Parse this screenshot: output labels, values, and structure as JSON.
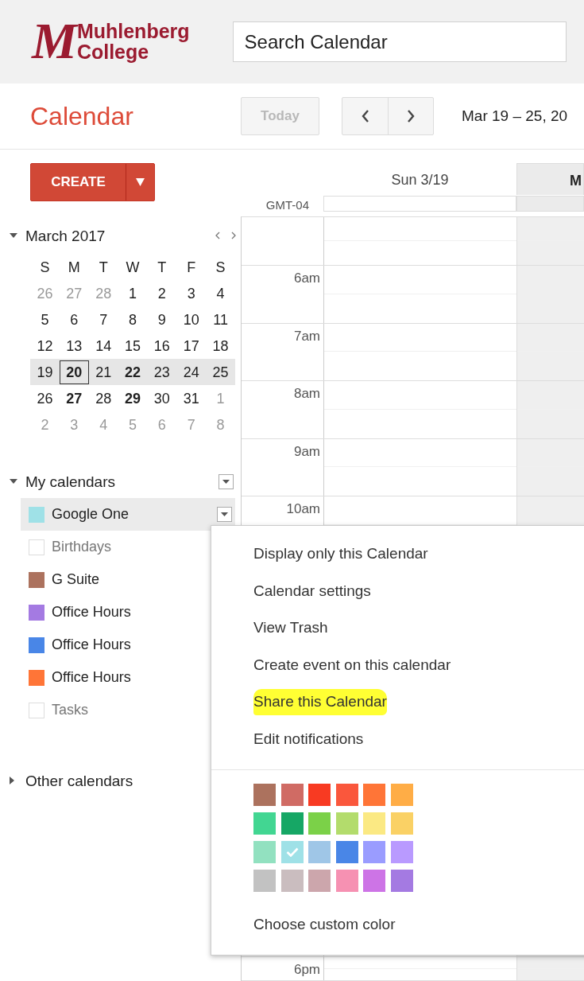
{
  "logo": {
    "monogram": "M",
    "lines": [
      "Muhlenberg",
      "College"
    ]
  },
  "search": {
    "placeholder": "Search Calendar"
  },
  "app_title": "Calendar",
  "toolbar": {
    "today": {
      "label": "Today",
      "disabled": true
    },
    "date_range": "Mar 19 – 25, 20"
  },
  "create": {
    "label": "CREATE"
  },
  "mini_calendar": {
    "title": "March 2017",
    "expanded": true,
    "weekdays": [
      "S",
      "M",
      "T",
      "W",
      "T",
      "F",
      "S"
    ],
    "weeks": [
      {
        "selected": false,
        "days": [
          {
            "label": "26",
            "other_month": true,
            "has_events": false,
            "today": false
          },
          {
            "label": "27",
            "other_month": true,
            "has_events": false,
            "today": false
          },
          {
            "label": "28",
            "other_month": true,
            "has_events": false,
            "today": false
          },
          {
            "label": "1",
            "other_month": false,
            "has_events": false,
            "today": false
          },
          {
            "label": "2",
            "other_month": false,
            "has_events": false,
            "today": false
          },
          {
            "label": "3",
            "other_month": false,
            "has_events": false,
            "today": false
          },
          {
            "label": "4",
            "other_month": false,
            "has_events": false,
            "today": false
          }
        ]
      },
      {
        "selected": false,
        "days": [
          {
            "label": "5",
            "other_month": false,
            "has_events": false,
            "today": false
          },
          {
            "label": "6",
            "other_month": false,
            "has_events": false,
            "today": false
          },
          {
            "label": "7",
            "other_month": false,
            "has_events": false,
            "today": false
          },
          {
            "label": "8",
            "other_month": false,
            "has_events": false,
            "today": false
          },
          {
            "label": "9",
            "other_month": false,
            "has_events": false,
            "today": false
          },
          {
            "label": "10",
            "other_month": false,
            "has_events": false,
            "today": false
          },
          {
            "label": "11",
            "other_month": false,
            "has_events": false,
            "today": false
          }
        ]
      },
      {
        "selected": false,
        "days": [
          {
            "label": "12",
            "other_month": false,
            "has_events": false,
            "today": false
          },
          {
            "label": "13",
            "other_month": false,
            "has_events": false,
            "today": false
          },
          {
            "label": "14",
            "other_month": false,
            "has_events": false,
            "today": false
          },
          {
            "label": "15",
            "other_month": false,
            "has_events": false,
            "today": false
          },
          {
            "label": "16",
            "other_month": false,
            "has_events": false,
            "today": false
          },
          {
            "label": "17",
            "other_month": false,
            "has_events": false,
            "today": false
          },
          {
            "label": "18",
            "other_month": false,
            "has_events": false,
            "today": false
          }
        ]
      },
      {
        "selected": true,
        "days": [
          {
            "label": "19",
            "other_month": false,
            "has_events": false,
            "today": false
          },
          {
            "label": "20",
            "other_month": false,
            "has_events": true,
            "today": true
          },
          {
            "label": "21",
            "other_month": false,
            "has_events": false,
            "today": false
          },
          {
            "label": "22",
            "other_month": false,
            "has_events": true,
            "today": false
          },
          {
            "label": "23",
            "other_month": false,
            "has_events": false,
            "today": false
          },
          {
            "label": "24",
            "other_month": false,
            "has_events": false,
            "today": false
          },
          {
            "label": "25",
            "other_month": false,
            "has_events": false,
            "today": false
          }
        ]
      },
      {
        "selected": false,
        "days": [
          {
            "label": "26",
            "other_month": false,
            "has_events": false,
            "today": false
          },
          {
            "label": "27",
            "other_month": false,
            "has_events": true,
            "today": false
          },
          {
            "label": "28",
            "other_month": false,
            "has_events": false,
            "today": false
          },
          {
            "label": "29",
            "other_month": false,
            "has_events": true,
            "today": false
          },
          {
            "label": "30",
            "other_month": false,
            "has_events": false,
            "today": false
          },
          {
            "label": "31",
            "other_month": false,
            "has_events": false,
            "today": false
          },
          {
            "label": "1",
            "other_month": true,
            "has_events": false,
            "today": false
          }
        ]
      },
      {
        "selected": false,
        "days": [
          {
            "label": "2",
            "other_month": true,
            "has_events": false,
            "today": false
          },
          {
            "label": "3",
            "other_month": true,
            "has_events": false,
            "today": false
          },
          {
            "label": "4",
            "other_month": true,
            "has_events": false,
            "today": false
          },
          {
            "label": "5",
            "other_month": true,
            "has_events": false,
            "today": false
          },
          {
            "label": "6",
            "other_month": true,
            "has_events": false,
            "today": false
          },
          {
            "label": "7",
            "other_month": true,
            "has_events": false,
            "today": false
          },
          {
            "label": "8",
            "other_month": true,
            "has_events": false,
            "today": false
          }
        ]
      }
    ]
  },
  "my_calendars": {
    "title": "My calendars",
    "expanded": true,
    "items": [
      {
        "label": "Google One",
        "checked": true,
        "color": "#9fe1e7",
        "selected": true
      },
      {
        "label": "Birthdays",
        "checked": false,
        "selected": false
      },
      {
        "label": "G Suite",
        "checked": true,
        "color": "#ac725e",
        "selected": false
      },
      {
        "label": "Office Hours",
        "checked": true,
        "color": "#a47ae2",
        "selected": false
      },
      {
        "label": "Office Hours",
        "checked": true,
        "color": "#4986e7",
        "selected": false
      },
      {
        "label": "Office Hours",
        "checked": true,
        "color": "#ff7537",
        "selected": false
      },
      {
        "label": "Tasks",
        "checked": false,
        "selected": false
      }
    ]
  },
  "other_calendars": {
    "title": "Other calendars",
    "expanded": false
  },
  "week_view": {
    "timezone": "GMT-04",
    "days": [
      {
        "label": "Sun 3/19",
        "today": false
      },
      {
        "label": "M",
        "today": true
      }
    ],
    "hours": [
      "6am",
      "7am",
      "8am",
      "9am",
      "10am"
    ],
    "bottom_hour": "6pm"
  },
  "menu": {
    "items": [
      {
        "label": "Display only this Calendar",
        "highlighted": false
      },
      {
        "label": "Calendar settings",
        "highlighted": false
      },
      {
        "label": "View Trash",
        "highlighted": false
      },
      {
        "label": "Create event on this calendar",
        "highlighted": false
      },
      {
        "label": "Share this Calendar",
        "highlighted": true
      },
      {
        "label": "Edit notifications",
        "highlighted": false
      }
    ],
    "swatches": [
      {
        "color": "#ac725e",
        "selected": false
      },
      {
        "color": "#d06b64",
        "selected": false
      },
      {
        "color": "#f83a22",
        "selected": false
      },
      {
        "color": "#fa573c",
        "selected": false
      },
      {
        "color": "#ff7537",
        "selected": false
      },
      {
        "color": "#ffad46",
        "selected": false
      },
      {
        "color": "#42d692",
        "selected": false
      },
      {
        "color": "#16a765",
        "selected": false
      },
      {
        "color": "#7bd148",
        "selected": false
      },
      {
        "color": "#b3dc6c",
        "selected": false
      },
      {
        "color": "#fbe983",
        "selected": false
      },
      {
        "color": "#fad165",
        "selected": false
      },
      {
        "color": "#92e1c0",
        "selected": false
      },
      {
        "color": "#9fe1e7",
        "selected": true
      },
      {
        "color": "#9fc6e7",
        "selected": false
      },
      {
        "color": "#4986e7",
        "selected": false
      },
      {
        "color": "#9a9cff",
        "selected": false
      },
      {
        "color": "#b99aff",
        "selected": false
      },
      {
        "color": "#c2c2c2",
        "selected": false
      },
      {
        "color": "#cabdbf",
        "selected": false
      },
      {
        "color": "#cca6ac",
        "selected": false
      },
      {
        "color": "#f691b2",
        "selected": false
      },
      {
        "color": "#cd74e6",
        "selected": false
      },
      {
        "color": "#a47ae2",
        "selected": false
      }
    ],
    "custom_label": "Choose custom color"
  }
}
